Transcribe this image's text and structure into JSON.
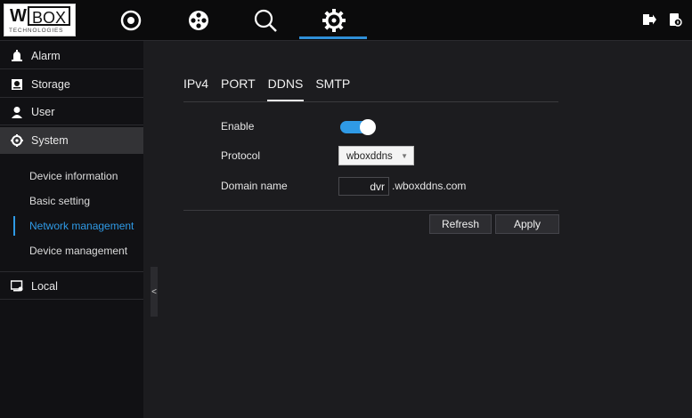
{
  "logo": {
    "word_a": "W",
    "word_b": "BOX",
    "tagline": "TECHNOLOGIES"
  },
  "topnav": {
    "icons": [
      "live-view-icon",
      "playback-icon",
      "search-icon",
      "settings-icon"
    ],
    "active": "settings-icon",
    "right_icons": [
      "logout-icon",
      "lock-icon"
    ],
    "accent": "#2f8fd8"
  },
  "sidebar": {
    "items": [
      {
        "label": "Alarm",
        "icon": "alarm-icon"
      },
      {
        "label": "Storage",
        "icon": "storage-icon"
      },
      {
        "label": "User",
        "icon": "user-icon"
      },
      {
        "label": "System",
        "icon": "system-gear-icon",
        "selected": true
      },
      {
        "label": "Local",
        "icon": "local-icon"
      }
    ],
    "system_sub": [
      {
        "label": "Device information"
      },
      {
        "label": "Basic setting"
      },
      {
        "label": "Network management",
        "active": true
      },
      {
        "label": "Device management"
      }
    ],
    "collapse_glyph": "<"
  },
  "tabs": [
    {
      "label": "IPv4"
    },
    {
      "label": "PORT"
    },
    {
      "label": "DDNS",
      "active": true
    },
    {
      "label": "SMTP"
    }
  ],
  "form": {
    "enable_label": "Enable",
    "enable_value": true,
    "protocol_label": "Protocol",
    "protocol_value": "wboxddns",
    "domain_label": "Domain name",
    "domain_value": "dvr",
    "domain_suffix": ".wboxddns.com"
  },
  "buttons": {
    "refresh": "Refresh",
    "apply": "Apply"
  }
}
